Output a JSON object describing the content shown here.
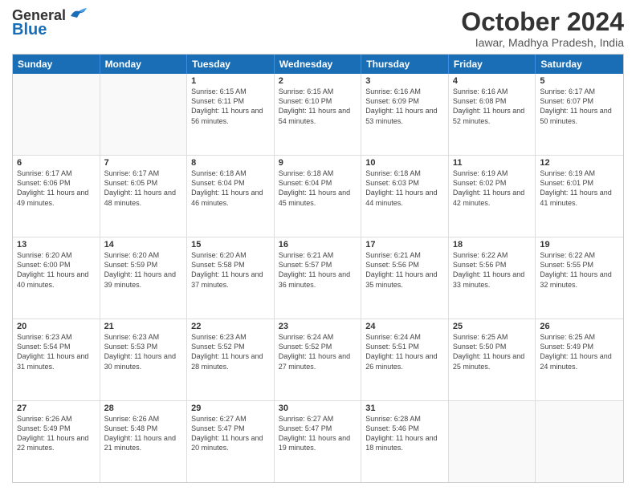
{
  "header": {
    "logo_line1": "General",
    "logo_line2": "Blue",
    "month_title": "October 2024",
    "location": "Iawar, Madhya Pradesh, India"
  },
  "days_of_week": [
    "Sunday",
    "Monday",
    "Tuesday",
    "Wednesday",
    "Thursday",
    "Friday",
    "Saturday"
  ],
  "weeks": [
    [
      {
        "day": "",
        "sunrise": "",
        "sunset": "",
        "daylight": "",
        "empty": true
      },
      {
        "day": "",
        "sunrise": "",
        "sunset": "",
        "daylight": "",
        "empty": true
      },
      {
        "day": "1",
        "sunrise": "6:15 AM",
        "sunset": "6:11 PM",
        "daylight": "11 hours and 56 minutes."
      },
      {
        "day": "2",
        "sunrise": "6:15 AM",
        "sunset": "6:10 PM",
        "daylight": "11 hours and 54 minutes."
      },
      {
        "day": "3",
        "sunrise": "6:16 AM",
        "sunset": "6:09 PM",
        "daylight": "11 hours and 53 minutes."
      },
      {
        "day": "4",
        "sunrise": "6:16 AM",
        "sunset": "6:08 PM",
        "daylight": "11 hours and 52 minutes."
      },
      {
        "day": "5",
        "sunrise": "6:17 AM",
        "sunset": "6:07 PM",
        "daylight": "11 hours and 50 minutes."
      }
    ],
    [
      {
        "day": "6",
        "sunrise": "6:17 AM",
        "sunset": "6:06 PM",
        "daylight": "11 hours and 49 minutes."
      },
      {
        "day": "7",
        "sunrise": "6:17 AM",
        "sunset": "6:05 PM",
        "daylight": "11 hours and 48 minutes."
      },
      {
        "day": "8",
        "sunrise": "6:18 AM",
        "sunset": "6:04 PM",
        "daylight": "11 hours and 46 minutes."
      },
      {
        "day": "9",
        "sunrise": "6:18 AM",
        "sunset": "6:04 PM",
        "daylight": "11 hours and 45 minutes."
      },
      {
        "day": "10",
        "sunrise": "6:18 AM",
        "sunset": "6:03 PM",
        "daylight": "11 hours and 44 minutes."
      },
      {
        "day": "11",
        "sunrise": "6:19 AM",
        "sunset": "6:02 PM",
        "daylight": "11 hours and 42 minutes."
      },
      {
        "day": "12",
        "sunrise": "6:19 AM",
        "sunset": "6:01 PM",
        "daylight": "11 hours and 41 minutes."
      }
    ],
    [
      {
        "day": "13",
        "sunrise": "6:20 AM",
        "sunset": "6:00 PM",
        "daylight": "11 hours and 40 minutes."
      },
      {
        "day": "14",
        "sunrise": "6:20 AM",
        "sunset": "5:59 PM",
        "daylight": "11 hours and 39 minutes."
      },
      {
        "day": "15",
        "sunrise": "6:20 AM",
        "sunset": "5:58 PM",
        "daylight": "11 hours and 37 minutes."
      },
      {
        "day": "16",
        "sunrise": "6:21 AM",
        "sunset": "5:57 PM",
        "daylight": "11 hours and 36 minutes."
      },
      {
        "day": "17",
        "sunrise": "6:21 AM",
        "sunset": "5:56 PM",
        "daylight": "11 hours and 35 minutes."
      },
      {
        "day": "18",
        "sunrise": "6:22 AM",
        "sunset": "5:56 PM",
        "daylight": "11 hours and 33 minutes."
      },
      {
        "day": "19",
        "sunrise": "6:22 AM",
        "sunset": "5:55 PM",
        "daylight": "11 hours and 32 minutes."
      }
    ],
    [
      {
        "day": "20",
        "sunrise": "6:23 AM",
        "sunset": "5:54 PM",
        "daylight": "11 hours and 31 minutes."
      },
      {
        "day": "21",
        "sunrise": "6:23 AM",
        "sunset": "5:53 PM",
        "daylight": "11 hours and 30 minutes."
      },
      {
        "day": "22",
        "sunrise": "6:23 AM",
        "sunset": "5:52 PM",
        "daylight": "11 hours and 28 minutes."
      },
      {
        "day": "23",
        "sunrise": "6:24 AM",
        "sunset": "5:52 PM",
        "daylight": "11 hours and 27 minutes."
      },
      {
        "day": "24",
        "sunrise": "6:24 AM",
        "sunset": "5:51 PM",
        "daylight": "11 hours and 26 minutes."
      },
      {
        "day": "25",
        "sunrise": "6:25 AM",
        "sunset": "5:50 PM",
        "daylight": "11 hours and 25 minutes."
      },
      {
        "day": "26",
        "sunrise": "6:25 AM",
        "sunset": "5:49 PM",
        "daylight": "11 hours and 24 minutes."
      }
    ],
    [
      {
        "day": "27",
        "sunrise": "6:26 AM",
        "sunset": "5:49 PM",
        "daylight": "11 hours and 22 minutes."
      },
      {
        "day": "28",
        "sunrise": "6:26 AM",
        "sunset": "5:48 PM",
        "daylight": "11 hours and 21 minutes."
      },
      {
        "day": "29",
        "sunrise": "6:27 AM",
        "sunset": "5:47 PM",
        "daylight": "11 hours and 20 minutes."
      },
      {
        "day": "30",
        "sunrise": "6:27 AM",
        "sunset": "5:47 PM",
        "daylight": "11 hours and 19 minutes."
      },
      {
        "day": "31",
        "sunrise": "6:28 AM",
        "sunset": "5:46 PM",
        "daylight": "11 hours and 18 minutes."
      },
      {
        "day": "",
        "sunrise": "",
        "sunset": "",
        "daylight": "",
        "empty": true
      },
      {
        "day": "",
        "sunrise": "",
        "sunset": "",
        "daylight": "",
        "empty": true
      }
    ]
  ]
}
